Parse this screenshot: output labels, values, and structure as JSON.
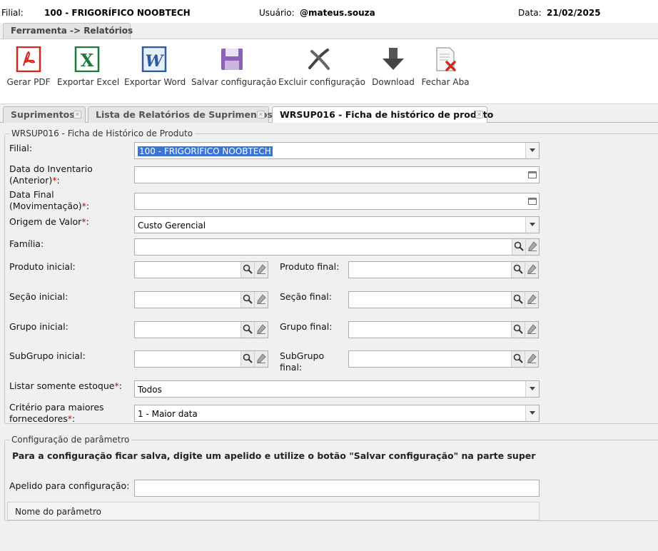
{
  "header": {
    "filial_label": "Filial:",
    "filial_value": "100 - FRIGORÍFICO NOOBTECH",
    "user_label": "Usuário:",
    "user_value": "@mateus.souza",
    "date_label": "Data:",
    "date_value": "21/02/2025"
  },
  "breadcrumb_tab": "Ferramenta -> Relatórios",
  "toolbar": [
    {
      "label": "Gerar PDF",
      "icon": "pdf-icon"
    },
    {
      "label": "Exportar Excel",
      "icon": "excel-icon"
    },
    {
      "label": "Exportar Word",
      "icon": "word-icon"
    },
    {
      "label": "Salvar configuração",
      "icon": "save-icon"
    },
    {
      "label": "Excluir configuração",
      "icon": "delete-icon"
    },
    {
      "label": "Download",
      "icon": "download-arrow-icon"
    },
    {
      "label": "Fechar Aba",
      "icon": "close-document-icon"
    }
  ],
  "tabs": [
    {
      "label": "Suprimentos"
    },
    {
      "label": "Lista de Relatórios de Suprimentos"
    },
    {
      "label": "WRSUP016 - Ficha de histórico de produto"
    }
  ],
  "form": {
    "legend": "WRSUP016 - Ficha de Histórico de Produto",
    "filial": {
      "label": "Filial:",
      "value": "100 - FRIGORÍFICO NOOBTECH"
    },
    "data_inventario": {
      "label_line1": "Data do Inventario",
      "label_line2": "(Anterior)",
      "value": ""
    },
    "data_final": {
      "label_line1": "Data Final",
      "label_line2": "(Movimentação)",
      "value": ""
    },
    "origem_valor": {
      "label": "Origem de Valor",
      "value": "Custo Gerencial"
    },
    "familia": {
      "label": "Família:",
      "value": ""
    },
    "produto_inicial": {
      "label": "Produto inicial:",
      "value": ""
    },
    "produto_final": {
      "label": "Produto final:",
      "value": ""
    },
    "secao_inicial": {
      "label": "Seção inicial:",
      "value": ""
    },
    "secao_final": {
      "label": "Seção final:",
      "value": ""
    },
    "grupo_inicial": {
      "label": "Grupo inicial:",
      "value": ""
    },
    "grupo_final": {
      "label": "Grupo final:",
      "value": ""
    },
    "subgrupo_inicial": {
      "label": "SubGrupo inicial:",
      "value": ""
    },
    "subgrupo_final": {
      "label_line1": "SubGrupo",
      "label_line2": "final:",
      "value": ""
    },
    "listar_estoque": {
      "label": "Listar somente estoque",
      "value": "Todos"
    },
    "criterio": {
      "label_line1": "Critério para maiores",
      "label_line2": "fornecedores",
      "value": "1 - Maior data"
    },
    "required_mark": "*",
    "colon": ":"
  },
  "config": {
    "legend": "Configuração de parâmetro",
    "info": "Para a configuração ficar salva, digite um apelido e utilize o botão \"Salvar configuração\" na parte superior da tela. O ap",
    "apelido_label": "Apelido para configuração:",
    "apelido_value": "",
    "grid_header": "Nome do parâmetro"
  },
  "colors": {
    "accent_selection": "#3875d7",
    "required": "#dd0000",
    "pdf": "#d9261c",
    "excel": "#1d7b3a",
    "word": "#2a5aa8",
    "save": "#8a62b8"
  }
}
